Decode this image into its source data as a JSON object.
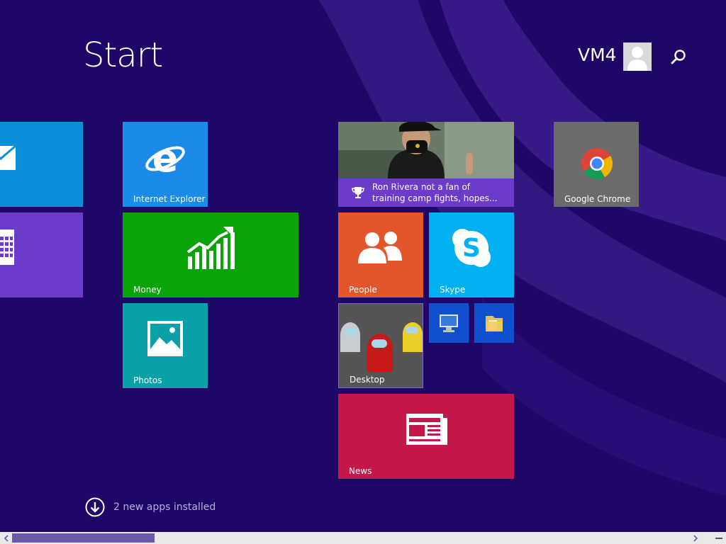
{
  "header": {
    "title": "Start",
    "user_name": "VM4"
  },
  "tiles": {
    "mail": {
      "label": "",
      "color": "#0a8fd8"
    },
    "calendar": {
      "label": "",
      "color": "#6b3cc9"
    },
    "internet_explorer": {
      "label": "Internet Explorer",
      "color": "#1c8ae8"
    },
    "money": {
      "label": "Money",
      "color": "#0aa30a"
    },
    "photos": {
      "label": "Photos",
      "color": "#0aa0a8"
    },
    "sports_news": {
      "headline_line1": "Ron Rivera not a fan of",
      "headline_line2": "training camp fights, hopes..."
    },
    "google_chrome": {
      "label": "Google Chrome",
      "color": "#6b6b6b"
    },
    "people": {
      "label": "People",
      "color": "#e3552a"
    },
    "skype": {
      "label": "Skype",
      "color": "#00b0f0"
    },
    "desktop": {
      "label": "Desktop"
    },
    "this_pc": {
      "label": ""
    },
    "file_explorer": {
      "label": ""
    },
    "news": {
      "label": "News",
      "color": "#c4184a"
    }
  },
  "footer": {
    "apps_notice": "2 new apps installed"
  },
  "scrollbar": {
    "position_fraction": 0.0,
    "visible_fraction": 0.21
  }
}
